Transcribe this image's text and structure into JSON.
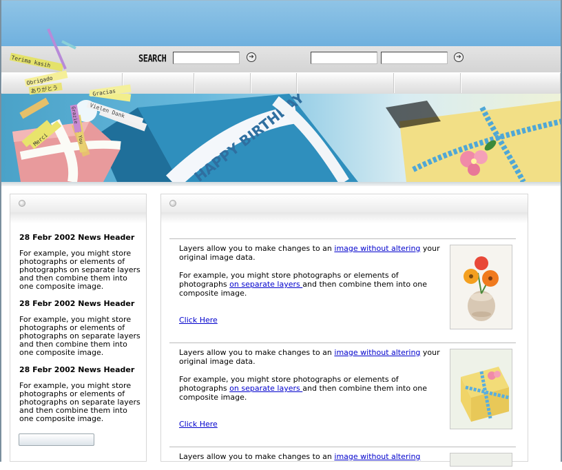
{
  "search": {
    "label": "SEARCH",
    "input1_value": "",
    "input2_value": "",
    "input3_value": ""
  },
  "banner": {
    "ribbon_text": "HAPPY BIRTHDAY",
    "tag_words": [
      "Terima kasih",
      "Obrigado",
      "ありがとう",
      "Gracias",
      "Vielen Dank",
      "Merci",
      "Thank You",
      "Grazie"
    ]
  },
  "left_news": [
    {
      "header": "28 Febr 2002 News Header",
      "body": "For example, you might store photographs or elements of photographs on separate layers and then combine them into one composite image."
    },
    {
      "header": "28 Febr 2002 News Header",
      "body": "For example, you might store photographs or elements of photographs on separate layers and then combine them into one composite image."
    },
    {
      "header": "28 Febr 2002 News Header",
      "body": "For example, you might store photographs or elements of photographs on separate layers and then combine them into one composite image."
    }
  ],
  "articles": [
    {
      "p1_before": "Layers allow you to make changes to an ",
      "p1_link": "image without altering",
      "p1_after": " your original image data.",
      "p2_before": "For example, you might store photographs or elements of photographs ",
      "p2_link": "on separate layers ",
      "p2_after": "and then combine them into one composite image.",
      "click": "Click Here"
    },
    {
      "p1_before": "Layers allow you to make changes to an ",
      "p1_link": "image without altering",
      "p1_after": " your original image data.",
      "p2_before": "For example, you might store photographs or elements of photographs ",
      "p2_link": "on separate layers ",
      "p2_after": "and then combine them into one composite image.",
      "click": "Click Here"
    },
    {
      "p1_before": "Layers allow you to make changes to an ",
      "p1_link": "image without altering",
      "p1_after": "",
      "p2_before": "",
      "p2_link": "",
      "p2_after": "",
      "click": ""
    }
  ],
  "colors": {
    "link": "#0000cc",
    "sky": "#7ab8e2",
    "bar": "#dcdcdc"
  }
}
